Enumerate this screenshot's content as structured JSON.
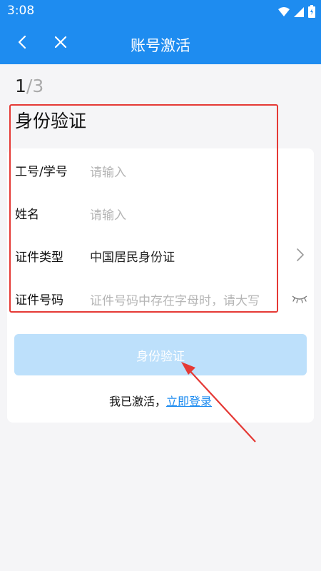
{
  "status_bar": {
    "time": "3:08",
    "icons": [
      "wifi-icon",
      "signal-icon",
      "battery-icon"
    ]
  },
  "app_bar": {
    "title": "账号激活",
    "back_icon": "back-chevron-icon",
    "close_icon": "close-icon"
  },
  "step": {
    "current": "1",
    "separator_total": "/3"
  },
  "section_title": "身份验证",
  "fields": [
    {
      "label": "工号/学号",
      "placeholder": "请输入"
    },
    {
      "label": "姓名",
      "placeholder": "请输入"
    },
    {
      "label": "证件类型",
      "value": "中国居民身份证",
      "icon": "chevron-right-icon"
    },
    {
      "label": "证件号码",
      "placeholder": "证件号码中存在字母时，请大写",
      "icon": "eye-closed-icon"
    }
  ],
  "submit_label": "身份验证",
  "login_prompt": {
    "text": "我已激活，",
    "link": "立即登录"
  },
  "colors": {
    "primary": "#1e8cf0",
    "button_disabled": "#bde0fb",
    "annotation": "#e53935"
  }
}
